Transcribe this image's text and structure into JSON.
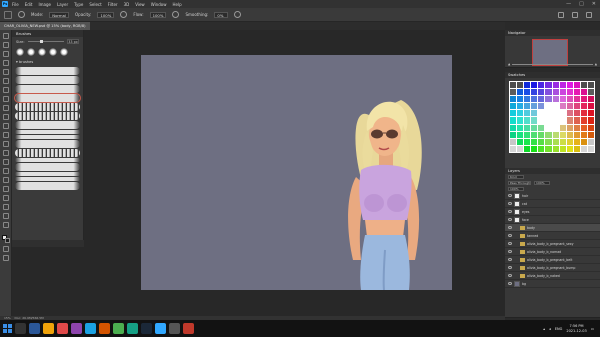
{
  "app": {
    "logo": "Ps",
    "menu": [
      "File",
      "Edit",
      "Image",
      "Layer",
      "Type",
      "Select",
      "Filter",
      "3D",
      "View",
      "Window",
      "Help"
    ],
    "window_controls": [
      "—",
      "□",
      "✕"
    ]
  },
  "options": {
    "mode_label": "Mode:",
    "mode_value": "Normal",
    "opacity_label": "Opacity:",
    "opacity_value": "100%",
    "flow_label": "Flow:",
    "flow_value": "100%",
    "smoothing_label": "Smoothing:",
    "smoothing_value": "0%"
  },
  "document": {
    "tab_title": "CHAR_OLIVIA_NEW.psd @ 15% (body, RGB/8)"
  },
  "brushes": {
    "title": "Brushes",
    "size_label": "Size:",
    "size_value": "33 px",
    "folder": "brushes"
  },
  "status": {
    "zoom": "15%",
    "info": "Doc: 26.9M/566.5M"
  },
  "navigator": {
    "title": "Navigator"
  },
  "swatches": {
    "title": "Swatches"
  },
  "layers_panel": {
    "title": "Layers",
    "kind_filter": "Kind",
    "blend_mode": "Pass Through",
    "opacity": "100%",
    "fill": "100%",
    "items": [
      {
        "name": "hair",
        "type": "layer"
      },
      {
        "name": "cat",
        "type": "layer"
      },
      {
        "name": "eyes",
        "type": "layer"
      },
      {
        "name": "face",
        "type": "layer"
      },
      {
        "name": "body",
        "type": "folder",
        "selected": true
      },
      {
        "name": "tanned",
        "type": "folder"
      },
      {
        "name": "olivia_body_b_pregnant_sexy",
        "type": "folder"
      },
      {
        "name": "olivia_body_b_nomad",
        "type": "folder"
      },
      {
        "name": "olivia_body_b_pregnant_belt",
        "type": "folder"
      },
      {
        "name": "olivia_body_b_pregnant_bump",
        "type": "folder"
      },
      {
        "name": "olivia_body_b_naked",
        "type": "folder"
      },
      {
        "name": "bg",
        "type": "background"
      }
    ]
  },
  "taskbar": {
    "time": "7:56 PM",
    "date": "2021-12-03",
    "lang": "ENG"
  },
  "colors": {
    "canvas": "#6e6f82",
    "ui_dark": "#282828",
    "panel": "#383838",
    "accent": "#31a8ff"
  }
}
